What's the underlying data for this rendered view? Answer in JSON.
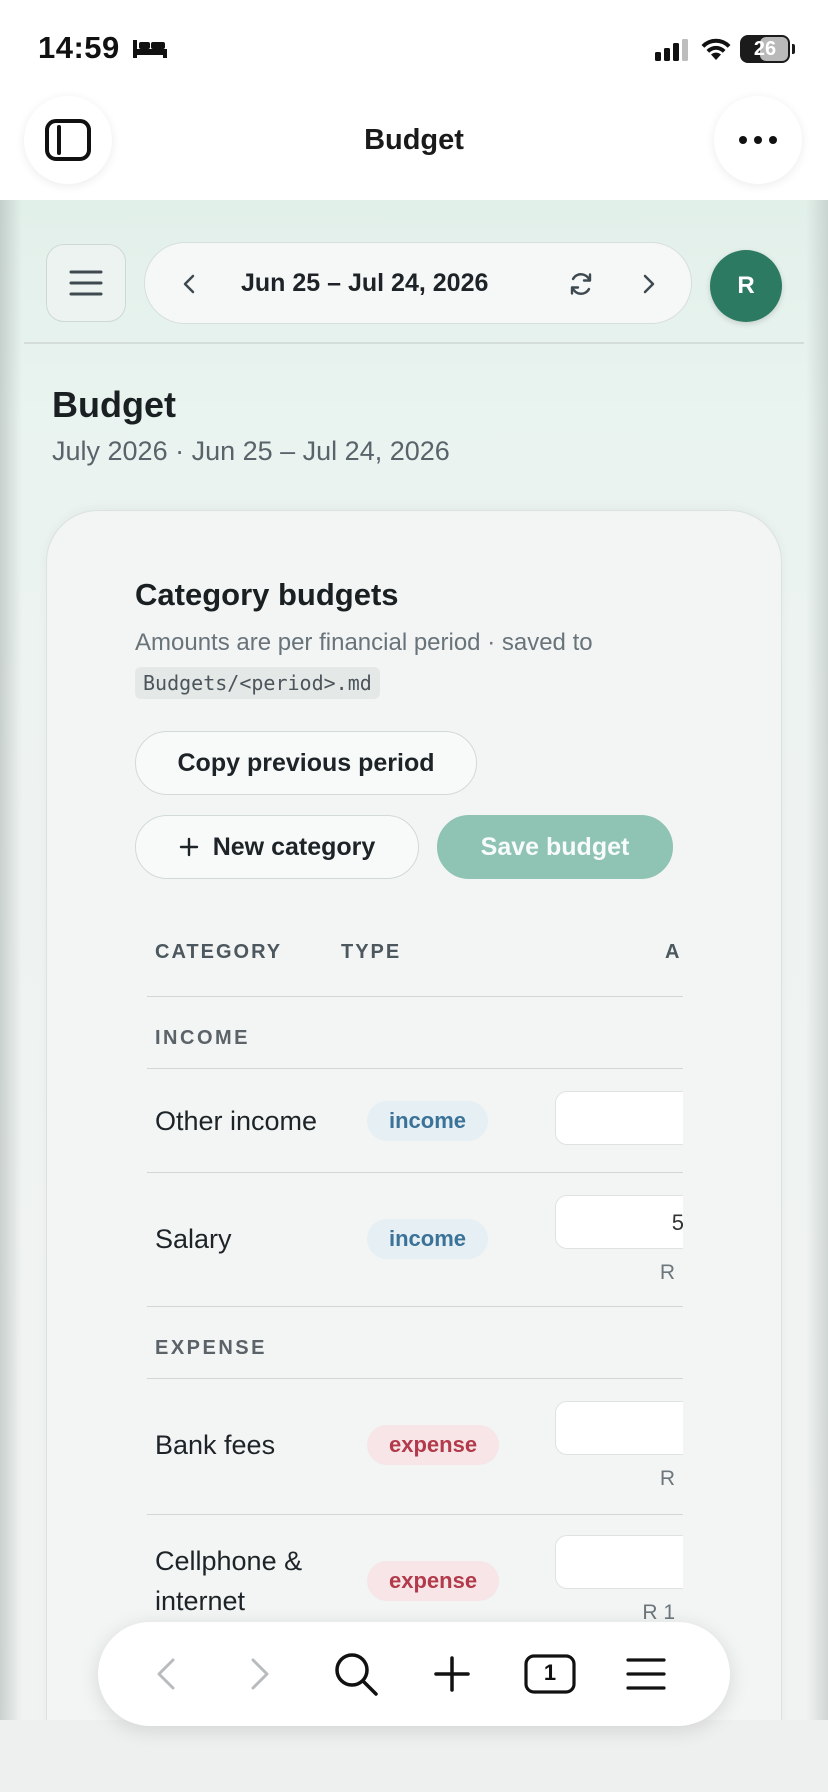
{
  "status_bar": {
    "time": "14:59",
    "battery": "26",
    "icons": [
      "bed-icon",
      "signal-icon",
      "wifi-icon",
      "battery-icon"
    ]
  },
  "browser": {
    "title": "Budget",
    "icons": [
      "sidebar-icon",
      "more-icon"
    ]
  },
  "app_header": {
    "period_label": "Jun 25 – Jul 24, 2026",
    "avatar_initial": "R",
    "icons": [
      "menu-icon",
      "chevron-left-icon",
      "refresh-icon",
      "chevron-right-icon"
    ]
  },
  "page": {
    "title": "Budget",
    "subtitle": "July 2026 · Jun 25 – Jul 24, 2026"
  },
  "card": {
    "title": "Category budgets",
    "description": "Amounts are per financial period · saved to",
    "path": "Budgets/<period>.md",
    "copy_button": "Copy previous period",
    "new_category_button": "New category",
    "save_button": "Save budget"
  },
  "table": {
    "headers": [
      "CATEGORY",
      "TYPE",
      "A"
    ],
    "groups": [
      {
        "label": "INCOME",
        "rows": [
          {
            "name": "Other income",
            "type": "income",
            "amount": "",
            "note": ""
          },
          {
            "name": "Salary",
            "type": "income",
            "amount": "5",
            "note": "R"
          }
        ]
      },
      {
        "label": "EXPENSE",
        "rows": [
          {
            "name": "Bank fees",
            "type": "expense",
            "amount": "",
            "note": "R"
          },
          {
            "name": "Cellphone & internet",
            "type": "expense",
            "amount": "",
            "note": "R 1"
          }
        ]
      }
    ]
  },
  "toolbar": {
    "tab_count": "1",
    "icons": [
      "back-icon",
      "forward-icon",
      "search-icon",
      "plus-icon",
      "tabs-icon",
      "hamburger-icon"
    ]
  },
  "colors": {
    "accent": "#2d7a63",
    "save_button": "#8fc3b3",
    "income_badge": "#3b7398",
    "expense_badge": "#b23a4a"
  }
}
